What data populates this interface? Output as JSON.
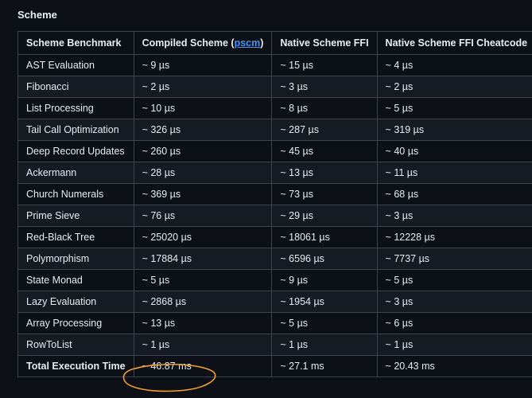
{
  "section": {
    "title": "Scheme"
  },
  "table": {
    "headers": {
      "benchmark": "Scheme Benchmark",
      "compiled_prefix": "Compiled Scheme (",
      "compiled_link": "pscm",
      "compiled_suffix": ")",
      "ffi": "Native Scheme FFI",
      "cheatcode": "Native Scheme FFI Cheatcode"
    },
    "rows": [
      {
        "name": "AST Evaluation",
        "compiled": "~ 9 µs",
        "ffi": "~ 15 µs",
        "cheat": "~ 4 µs"
      },
      {
        "name": "Fibonacci",
        "compiled": "~ 2 µs",
        "ffi": "~ 3 µs",
        "cheat": "~ 2 µs"
      },
      {
        "name": "List Processing",
        "compiled": "~ 10 µs",
        "ffi": "~ 8 µs",
        "cheat": "~ 5 µs"
      },
      {
        "name": "Tail Call Optimization",
        "compiled": "~ 326 µs",
        "ffi": "~ 287 µs",
        "cheat": "~ 319 µs"
      },
      {
        "name": "Deep Record Updates",
        "compiled": "~ 260 µs",
        "ffi": "~ 45 µs",
        "cheat": "~ 40 µs"
      },
      {
        "name": "Ackermann",
        "compiled": "~ 28 µs",
        "ffi": "~ 13 µs",
        "cheat": "~ 11 µs"
      },
      {
        "name": "Church Numerals",
        "compiled": "~ 369 µs",
        "ffi": "~ 73 µs",
        "cheat": "~ 68 µs"
      },
      {
        "name": "Prime Sieve",
        "compiled": "~ 76 µs",
        "ffi": "~ 29 µs",
        "cheat": "~ 3 µs"
      },
      {
        "name": "Red-Black Tree",
        "compiled": "~ 25020 µs",
        "ffi": "~ 18061 µs",
        "cheat": "~ 12228 µs"
      },
      {
        "name": "Polymorphism",
        "compiled": "~ 17884 µs",
        "ffi": "~ 6596 µs",
        "cheat": "~ 7737 µs"
      },
      {
        "name": "State Monad",
        "compiled": "~ 5 µs",
        "ffi": "~ 9 µs",
        "cheat": "~ 5 µs"
      },
      {
        "name": "Lazy Evaluation",
        "compiled": "~ 2868 µs",
        "ffi": "~ 1954 µs",
        "cheat": "~ 3 µs"
      },
      {
        "name": "Array Processing",
        "compiled": "~ 13 µs",
        "ffi": "~ 5 µs",
        "cheat": "~ 6 µs"
      },
      {
        "name": "RowToList",
        "compiled": "~ 1 µs",
        "ffi": "~ 1 µs",
        "cheat": "~ 1 µs"
      },
      {
        "name": "Total Execution Time",
        "compiled": "~ 46.87 ms",
        "ffi": "~ 27.1 ms",
        "cheat": "~ 20.43 ms"
      }
    ]
  },
  "colors": {
    "background": "#0d1117",
    "row_alt": "#151b23",
    "border": "#3d444d",
    "link": "#4493f8",
    "highlight": "#f0a030"
  }
}
